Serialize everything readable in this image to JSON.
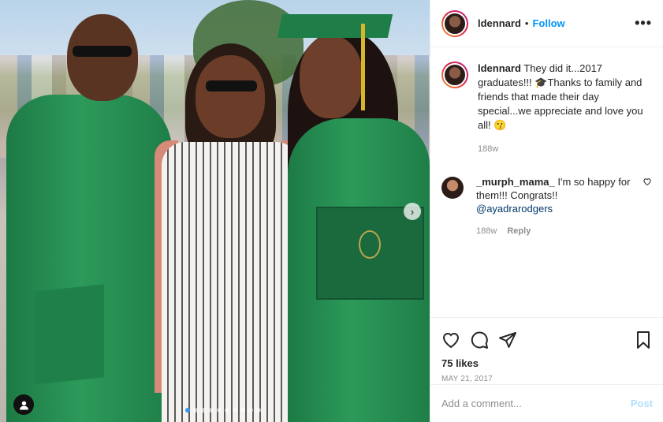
{
  "header": {
    "username": "ldennard",
    "separator": "•",
    "follow_label": "Follow",
    "more_icon": "more-horizontal-icon"
  },
  "caption": {
    "username": "ldennard",
    "text": "They did it...2017 graduates!!! 🎓Thanks to family and friends that made their day special...we appreciate and love you all! 😗",
    "age": "188w"
  },
  "comments": [
    {
      "username": "_murph_mama_",
      "text": "I'm so happy for them!!! Congrats!!",
      "mention": "@ayadrarodgers",
      "age": "188w",
      "reply_label": "Reply"
    }
  ],
  "actions": {
    "like_icon": "heart-icon",
    "comment_icon": "comment-icon",
    "share_icon": "send-icon",
    "save_icon": "bookmark-icon"
  },
  "likes": "75 likes",
  "date": "MAY 21, 2017",
  "add_comment": {
    "placeholder": "Add a comment...",
    "post_label": "Post"
  },
  "colors": {
    "accent": "#0095f6",
    "post_disabled": "#b2dffc",
    "muted": "#8e8e8e"
  }
}
